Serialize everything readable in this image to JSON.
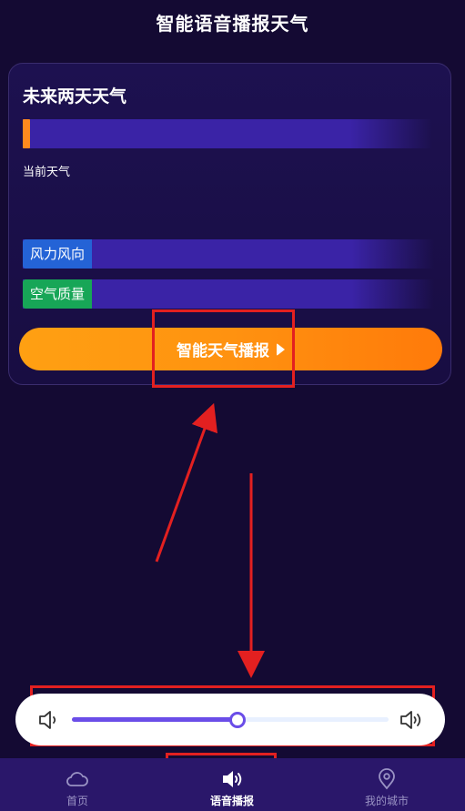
{
  "header": {
    "title": "智能语音播报天气"
  },
  "card": {
    "title": "未来两天天气",
    "current_label": "当前天气",
    "wind_label": "风力风向",
    "air_label": "空气质量",
    "broadcast_button": "智能天气播报"
  },
  "volume": {
    "level": 0.52
  },
  "tabs": [
    {
      "label": "首页",
      "icon": "cloud-icon"
    },
    {
      "label": "语音播报",
      "icon": "speaker-icon"
    },
    {
      "label": "我的城市",
      "icon": "location-pin-icon"
    }
  ],
  "colors": {
    "background": "#140a33",
    "accent_orange": "#ff9210",
    "slider": "#6a4de8",
    "annotation": "#e32020"
  }
}
